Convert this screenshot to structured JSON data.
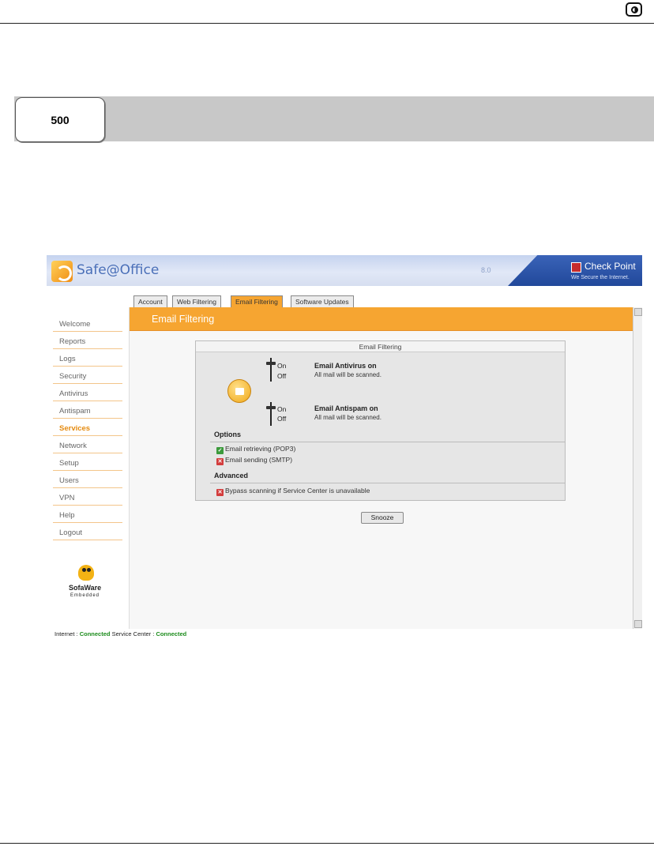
{
  "document": {
    "model_label": "500"
  },
  "app": {
    "brand": "Safe@Office",
    "version": "8.0",
    "vendor": "Check Point",
    "vendor_tagline": "We Secure the Internet."
  },
  "sidebar": {
    "items": [
      {
        "label": "Welcome",
        "active": false
      },
      {
        "label": "Reports",
        "active": false
      },
      {
        "label": "Logs",
        "active": false
      },
      {
        "label": "Security",
        "active": false
      },
      {
        "label": "Antivirus",
        "active": false
      },
      {
        "label": "Antispam",
        "active": false
      },
      {
        "label": "Services",
        "active": true
      },
      {
        "label": "Network",
        "active": false
      },
      {
        "label": "Setup",
        "active": false
      },
      {
        "label": "Users",
        "active": false
      },
      {
        "label": "VPN",
        "active": false
      },
      {
        "label": "Help",
        "active": false
      },
      {
        "label": "Logout",
        "active": false
      }
    ],
    "footer_brand": "SofaWare",
    "footer_sub": "Embedded"
  },
  "tabs": [
    {
      "label": "Account",
      "active": false
    },
    {
      "label": "Web Filtering",
      "active": false
    },
    {
      "label": "Email Filtering",
      "active": true
    },
    {
      "label": "Software Updates",
      "active": false
    }
  ],
  "page_title": "Email Filtering",
  "panel": {
    "header": "Email Filtering",
    "switch_on": "On",
    "switch_off": "Off",
    "features": [
      {
        "title": "Email Antivirus on",
        "desc": "All mail will be scanned."
      },
      {
        "title": "Email Antispam on",
        "desc": "All mail will be scanned."
      }
    ],
    "options_label": "Options",
    "options": [
      {
        "label": "Email retrieving (POP3)",
        "state": "on"
      },
      {
        "label": "Email sending (SMTP)",
        "state": "off"
      }
    ],
    "advanced_label": "Advanced",
    "advanced": [
      {
        "label": "Bypass scanning if Service Center is unavailable",
        "state": "off"
      }
    ]
  },
  "snooze_label": "Snooze",
  "status": {
    "internet_label": "Internet :",
    "internet_value": "Connected",
    "service_label": "Service Center :",
    "service_value": "Connected"
  },
  "colors": {
    "accent": "#f6a531",
    "active_nav": "#e58b10",
    "connected": "#1c8c1c"
  }
}
